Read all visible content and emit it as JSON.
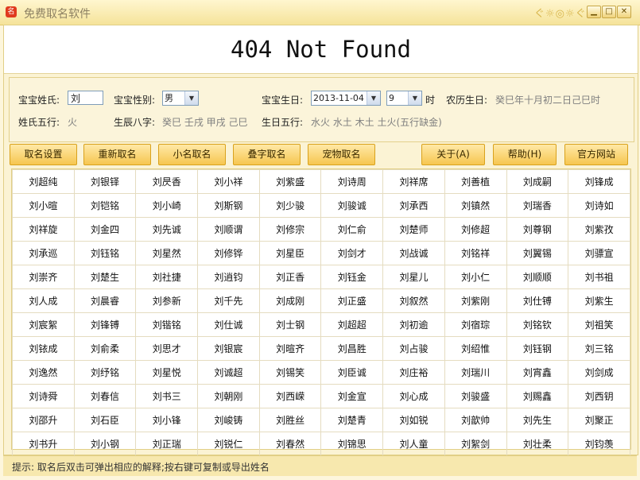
{
  "window": {
    "title": "免费取名软件",
    "deco": "ぐ☼◎☼ぐ",
    "min_symbol": "▁",
    "max_symbol": "□",
    "close_symbol": "✕",
    "icon_char": "名"
  },
  "banner": {
    "text": "404 Not Found"
  },
  "form": {
    "surname_label": "宝宝姓氏:",
    "surname_value": "刘",
    "gender_label": "宝宝性别:",
    "gender_value": "男",
    "birth_label": "宝宝生日:",
    "birth_date": "2013-11-04",
    "birth_hour": "9",
    "hour_unit": "时",
    "lunar_label": "农历生日:",
    "lunar_value": "癸巳年十月初二日己巳时",
    "element_label": "姓氏五行:",
    "element_value": "火",
    "bazi_label": "生辰八字:",
    "bazi_value": "癸巳 壬戌 甲戌 己巳",
    "birth_element_label": "生日五行:",
    "birth_element_value": "水火 水土 木土 土火(五行缺金)"
  },
  "buttons": {
    "name_settings": "取名设置",
    "regenerate": "重新取名",
    "nickname": "小名取名",
    "repeat_char": "叠字取名",
    "pet_name": "宠物取名",
    "about": "关于(A)",
    "help": "帮助(H)",
    "website": "官方网站"
  },
  "names": [
    [
      "刘超纯",
      "刘银铎",
      "刘昃香",
      "刘小祥",
      "刘紫盛",
      "刘诗周",
      "刘祥席",
      "刘善植",
      "刘成嗣",
      "刘锋成"
    ],
    [
      "刘小暄",
      "刘铠铭",
      "刘小崎",
      "刘斯钢",
      "刘少骏",
      "刘骏诚",
      "刘承西",
      "刘镇然",
      "刘瑞香",
      "刘诗如"
    ],
    [
      "刘祥旋",
      "刘金四",
      "刘先诚",
      "刘顺谓",
      "刘修宗",
      "刘仁俞",
      "刘楚师",
      "刘修超",
      "刘尊钢",
      "刘紫孜"
    ],
    [
      "刘承巡",
      "刘钰铭",
      "刘星然",
      "刘修铧",
      "刘星臣",
      "刘剑才",
      "刘战诚",
      "刘铭祥",
      "刘翼锡",
      "刘骠宣"
    ],
    [
      "刘崇齐",
      "刘楚生",
      "刘社捷",
      "刘逍钧",
      "刘正香",
      "刘钰金",
      "刘星儿",
      "刘小仁",
      "刘顺顺",
      "刘书祖"
    ],
    [
      "刘人成",
      "刘晨睿",
      "刘参新",
      "刘千先",
      "刘成刚",
      "刘正盛",
      "刘叙然",
      "刘紫刚",
      "刘仕镈",
      "刘紫生"
    ],
    [
      "刘宸絮",
      "刘锋镈",
      "刘锴铭",
      "刘仕诚",
      "刘士钢",
      "刘超超",
      "刘初逾",
      "刘宿琮",
      "刘铭钦",
      "刘祖笑"
    ],
    [
      "刘铱成",
      "刘俞柔",
      "刘思才",
      "刘银宸",
      "刘暄齐",
      "刘昌胜",
      "刘占骏",
      "刘绍惟",
      "刘钰钢",
      "刘三铭"
    ],
    [
      "刘逸然",
      "刘纾铭",
      "刘星悦",
      "刘诚超",
      "刘锡笑",
      "刘臣诚",
      "刘庄裕",
      "刘瑞川",
      "刘宵鑫",
      "刘剑成"
    ],
    [
      "刘诗舜",
      "刘春信",
      "刘书三",
      "刘朝刚",
      "刘西嵘",
      "刘金宣",
      "刘心成",
      "刘骏盛",
      "刘赐鑫",
      "刘西钥"
    ],
    [
      "刘邵升",
      "刘石臣",
      "刘小锋",
      "刘峻铸",
      "刘胜丝",
      "刘楚青",
      "刘如锐",
      "刘歆帅",
      "刘先生",
      "刘聚正"
    ],
    [
      "刘书升",
      "刘小钢",
      "刘正瑞",
      "刘锐仁",
      "刘春然",
      "刘锦思",
      "刘人童",
      "刘絮剑",
      "刘壮柔",
      "刘钧羡"
    ]
  ],
  "status": {
    "text": "提示: 取名后双击可弹出相应的解释;按右键可复制或导出姓名"
  }
}
